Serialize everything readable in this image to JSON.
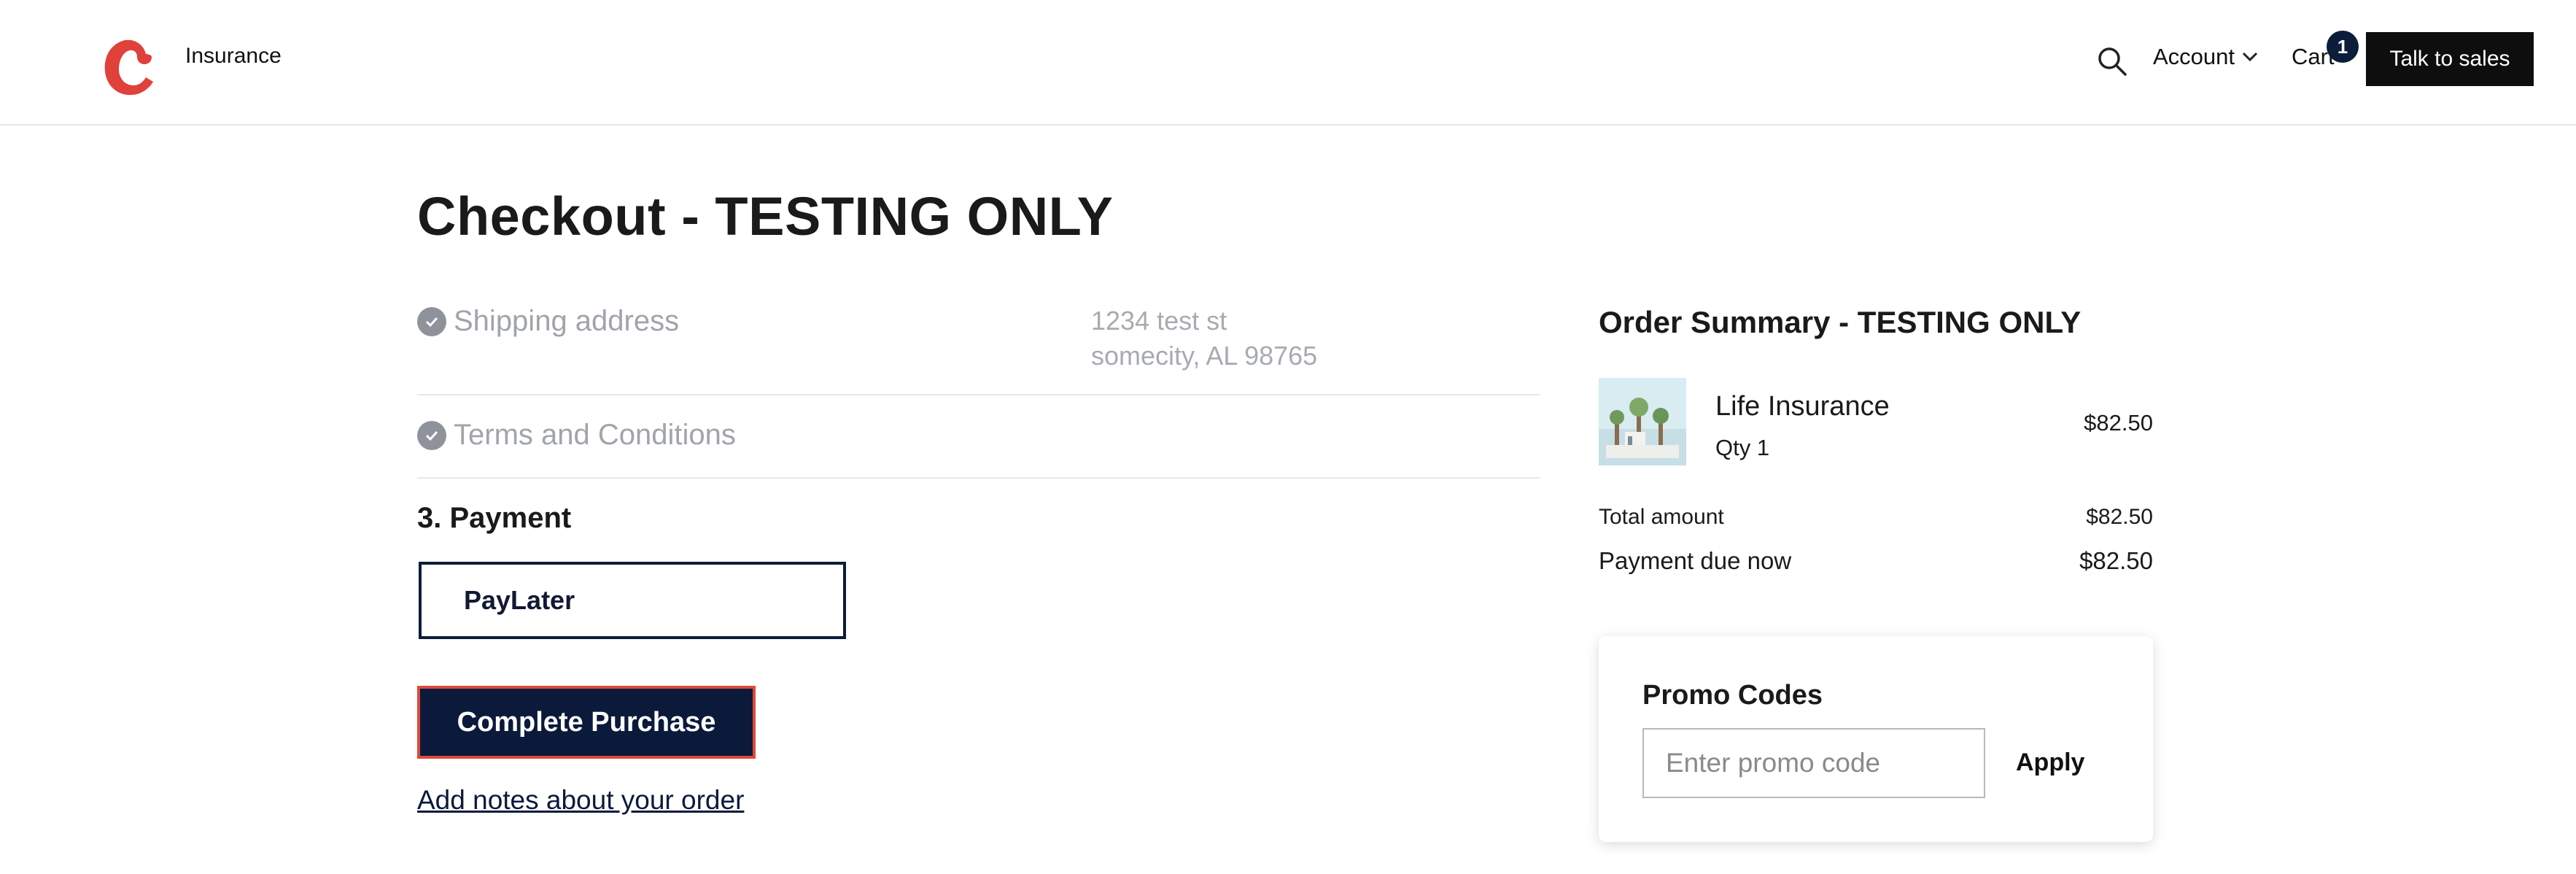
{
  "header": {
    "brand": "Insurance",
    "account_label": "Account",
    "cart_label": "Cart",
    "cart_count": "1",
    "sales_button": "Talk to sales",
    "brand_color": "#e0413b"
  },
  "checkout": {
    "title": "Checkout - TESTING ONLY",
    "steps": {
      "shipping": "Shipping address",
      "terms": "Terms and Conditions"
    },
    "address": {
      "line1": "1234 test st",
      "line2": "somecity, AL 98765"
    },
    "payment_title": "3. Payment",
    "payment_option": "PayLater",
    "complete_button": "Complete Purchase",
    "notes_link": "Add notes about your order"
  },
  "summary": {
    "title": "Order Summary - TESTING ONLY",
    "item": {
      "name": "Life Insurance",
      "qty": "Qty 1",
      "price": "$82.50"
    },
    "total_label": "Total amount",
    "total_value": "$82.50",
    "due_label": "Payment due now",
    "due_value": "$82.50"
  },
  "promo": {
    "title": "Promo Codes",
    "placeholder": "Enter promo code",
    "apply": "Apply"
  }
}
